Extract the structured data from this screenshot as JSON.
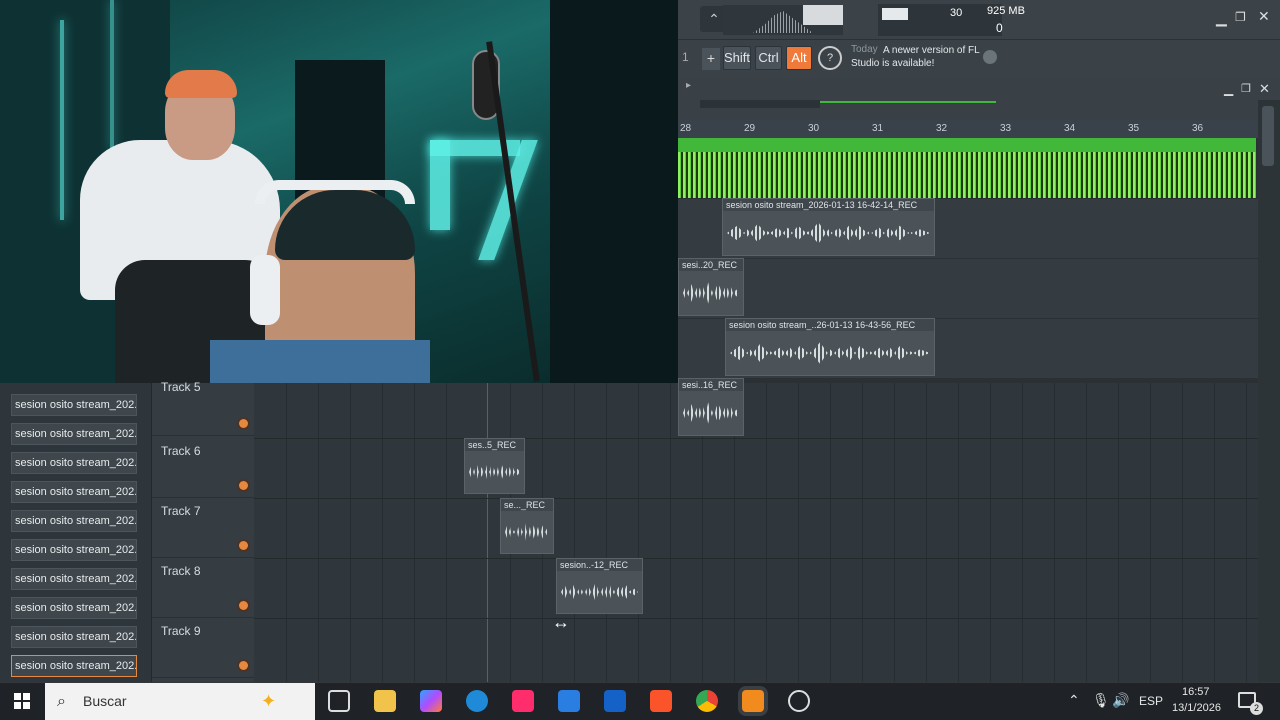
{
  "flstudio": {
    "cpu_value": "30",
    "memory": "925 MB",
    "poly": "0",
    "modifier_keys": [
      "Shift",
      "Ctrl",
      "Alt"
    ],
    "hint_prefix": "Today",
    "hint_text": "A newer version of FL Studio is available!",
    "pattern_num": "1",
    "ruler": [
      "28",
      "29",
      "30",
      "31",
      "32",
      "33",
      "34",
      "35",
      "36"
    ]
  },
  "upper_clips": [
    {
      "label": "sesion osito stream_2026-01-13 16-42-14_REC"
    },
    {
      "label": "sesi..20_REC"
    },
    {
      "label": "sesion osito stream_..26-01-13 16-43-56_REC"
    },
    {
      "label": "sesi..16_REC"
    }
  ],
  "browser": {
    "items": [
      "sesion osito stream_202...",
      "sesion osito stream_202...",
      "sesion osito stream_202...",
      "sesion osito stream_202...",
      "sesion osito stream_202...",
      "sesion osito stream_202...",
      "sesion osito stream_202...",
      "sesion osito stream_202...",
      "sesion osito stream_202...",
      "sesion osito stream_202..."
    ]
  },
  "tracks": [
    {
      "name": "Track 5"
    },
    {
      "name": "Track 6"
    },
    {
      "name": "Track 7"
    },
    {
      "name": "Track 8"
    },
    {
      "name": "Track 9"
    }
  ],
  "lower_clips": [
    {
      "label": "ses..5_REC"
    },
    {
      "label": "se..._REC"
    },
    {
      "label": "sesion..-12_REC"
    }
  ],
  "taskbar": {
    "search_placeholder": "Buscar",
    "language": "ESP",
    "time": "16:57",
    "date": "13/1/2026",
    "notifications": "2"
  },
  "colors": {
    "accent": "#f07a3a",
    "green": "#42b83a"
  }
}
